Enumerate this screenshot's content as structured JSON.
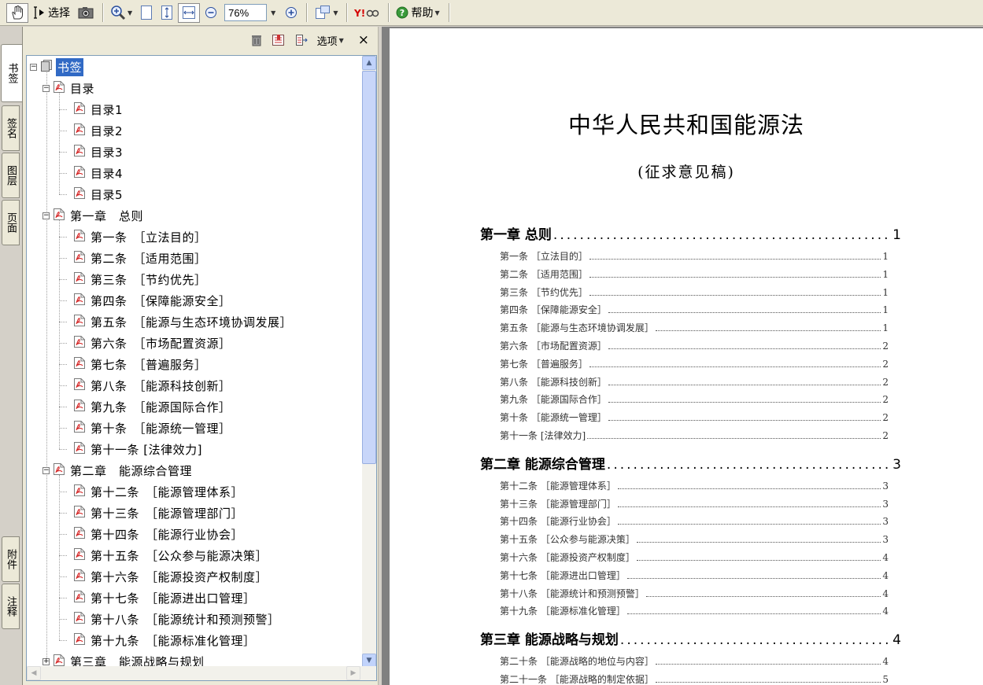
{
  "toolbar": {
    "select_label": "选择",
    "zoom_value": "76%",
    "help_label": "帮助"
  },
  "side_tabs": [
    "书签",
    "签名",
    "图层",
    "页面",
    "附件",
    "注释"
  ],
  "panel": {
    "options_label": "选项",
    "close_glyph": "×"
  },
  "tree": [
    {
      "label": "书签",
      "level": 0,
      "expander": "minus",
      "icon": "bookmark-root",
      "selected": true
    },
    {
      "label": "目录",
      "level": 1,
      "expander": "minus",
      "icon": "bookmark"
    },
    {
      "label": "目录1",
      "level": 2,
      "icon": "bookmark"
    },
    {
      "label": "目录2",
      "level": 2,
      "icon": "bookmark"
    },
    {
      "label": "目录3",
      "level": 2,
      "icon": "bookmark"
    },
    {
      "label": "目录4",
      "level": 2,
      "icon": "bookmark"
    },
    {
      "label": "目录5",
      "level": 2,
      "icon": "bookmark"
    },
    {
      "label": "第一章　总则",
      "level": 1,
      "expander": "minus",
      "icon": "bookmark"
    },
    {
      "label": "第一条　［立法目的］",
      "level": 2,
      "icon": "bookmark"
    },
    {
      "label": "第二条　［适用范围］",
      "level": 2,
      "icon": "bookmark"
    },
    {
      "label": "第三条　［节约优先］",
      "level": 2,
      "icon": "bookmark"
    },
    {
      "label": "第四条　［保障能源安全］",
      "level": 2,
      "icon": "bookmark"
    },
    {
      "label": "第五条　［能源与生态环境协调发展］",
      "level": 2,
      "icon": "bookmark"
    },
    {
      "label": "第六条　［市场配置资源］",
      "level": 2,
      "icon": "bookmark"
    },
    {
      "label": "第七条　［普遍服务］",
      "level": 2,
      "icon": "bookmark"
    },
    {
      "label": "第八条　［能源科技创新］",
      "level": 2,
      "icon": "bookmark"
    },
    {
      "label": "第九条　［能源国际合作］",
      "level": 2,
      "icon": "bookmark"
    },
    {
      "label": "第十条　［能源统一管理］",
      "level": 2,
      "icon": "bookmark"
    },
    {
      "label": "第十一条 [法律效力]",
      "level": 2,
      "icon": "bookmark"
    },
    {
      "label": "第二章　能源综合管理",
      "level": 1,
      "expander": "minus",
      "icon": "bookmark"
    },
    {
      "label": "第十二条　［能源管理体系］",
      "level": 2,
      "icon": "bookmark"
    },
    {
      "label": "第十三条　［能源管理部门］",
      "level": 2,
      "icon": "bookmark"
    },
    {
      "label": "第十四条　［能源行业协会］",
      "level": 2,
      "icon": "bookmark"
    },
    {
      "label": "第十五条　［公众参与能源决策］",
      "level": 2,
      "icon": "bookmark"
    },
    {
      "label": "第十六条　［能源投资产权制度］",
      "level": 2,
      "icon": "bookmark"
    },
    {
      "label": "第十七条　［能源进出口管理］",
      "level": 2,
      "icon": "bookmark"
    },
    {
      "label": "第十八条　［能源统计和预测预警］",
      "level": 2,
      "icon": "bookmark"
    },
    {
      "label": "第十九条　［能源标准化管理］",
      "level": 2,
      "icon": "bookmark"
    },
    {
      "label": "第三章　能源战略与规划",
      "level": 1,
      "expander": "plus",
      "icon": "bookmark"
    }
  ],
  "document": {
    "title": "中华人民共和国能源法",
    "subtitle": "(征求意见稿)",
    "toc": [
      {
        "kind": "chap",
        "text": "第一章  总则",
        "page": "1"
      },
      {
        "kind": "art",
        "text": "第一条  ［立法目的］",
        "page": "1"
      },
      {
        "kind": "art",
        "text": "第二条  ［适用范围］",
        "page": "1"
      },
      {
        "kind": "art",
        "text": "第三条  ［节约优先］",
        "page": "1"
      },
      {
        "kind": "art",
        "text": "第四条  ［保障能源安全］",
        "page": "1"
      },
      {
        "kind": "art",
        "text": "第五条  ［能源与生态环境协调发展］",
        "page": "1"
      },
      {
        "kind": "art",
        "text": "第六条  ［市场配置资源］",
        "page": "2"
      },
      {
        "kind": "art",
        "text": "第七条  ［普遍服务］",
        "page": "2"
      },
      {
        "kind": "art",
        "text": "第八条  ［能源科技创新］",
        "page": "2"
      },
      {
        "kind": "art",
        "text": "第九条  ［能源国际合作］",
        "page": "2"
      },
      {
        "kind": "art",
        "text": "第十条  ［能源统一管理］",
        "page": "2"
      },
      {
        "kind": "art",
        "text": "第十一条 [法律效力]",
        "page": "2"
      },
      {
        "kind": "chap",
        "text": "第二章  能源综合管理",
        "page": "3"
      },
      {
        "kind": "art",
        "text": "第十二条  ［能源管理体系］",
        "page": "3"
      },
      {
        "kind": "art",
        "text": "第十三条  ［能源管理部门］",
        "page": "3"
      },
      {
        "kind": "art",
        "text": "第十四条  ［能源行业协会］",
        "page": "3"
      },
      {
        "kind": "art",
        "text": "第十五条  ［公众参与能源决策］",
        "page": "3"
      },
      {
        "kind": "art",
        "text": "第十六条  ［能源投资产权制度］",
        "page": "4"
      },
      {
        "kind": "art",
        "text": "第十七条  ［能源进出口管理］",
        "page": "4"
      },
      {
        "kind": "art",
        "text": "第十八条  ［能源统计和预测预警］",
        "page": "4"
      },
      {
        "kind": "art",
        "text": "第十九条  ［能源标准化管理］",
        "page": "4"
      },
      {
        "kind": "chap",
        "text": "第三章  能源战略与规划",
        "page": "4"
      },
      {
        "kind": "art",
        "text": "第二十条  ［能源战略的地位与内容］",
        "page": "4"
      },
      {
        "kind": "art",
        "text": "第二十一条  ［能源战略的制定依据］",
        "page": "5"
      }
    ]
  }
}
